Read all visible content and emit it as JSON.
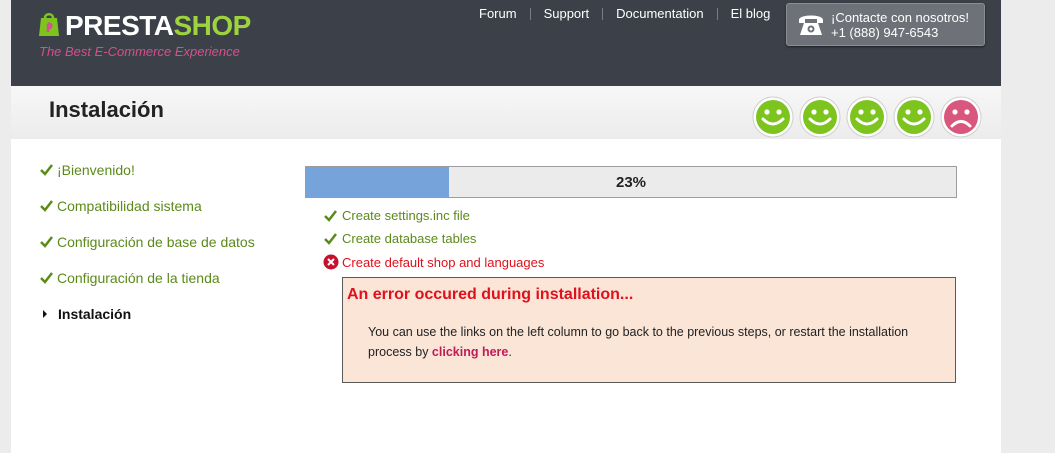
{
  "header": {
    "logo": {
      "word_part1": "PRESTA",
      "word_part2": "SHOP",
      "tagline": "The Best E-Commerce Experience"
    },
    "nav": [
      {
        "label": "Forum"
      },
      {
        "label": "Support"
      },
      {
        "label": "Documentation"
      },
      {
        "label": "El blog"
      }
    ],
    "contact": {
      "label": "¡Contacte con nosotros!",
      "phone": "+1 (888) 947-6543"
    }
  },
  "title": {
    "text": "Instalación"
  },
  "feedback": {
    "smileys": [
      "happy",
      "happy",
      "happy",
      "happy",
      "sad"
    ],
    "colors": {
      "happy": "#7dc41f",
      "sad": "#d9567f"
    }
  },
  "steps": [
    {
      "label": "¡Bienvenido!",
      "status": "done"
    },
    {
      "label": "Compatibilidad sistema",
      "status": "done"
    },
    {
      "label": "Configuración de base de datos",
      "status": "done"
    },
    {
      "label": "Configuración de la tienda",
      "status": "done"
    },
    {
      "label": "Instalación",
      "status": "current"
    }
  ],
  "progress": {
    "percent_label": "23%",
    "fraction": 0.22
  },
  "tasks": [
    {
      "label": "Create settings.inc file",
      "status": "ok"
    },
    {
      "label": "Create database tables",
      "status": "ok"
    },
    {
      "label": "Create default shop and languages",
      "status": "error"
    }
  ],
  "error": {
    "title": "An error occured during installation...",
    "message_before": "You can use the links on the left column to go back to the previous steps, or restart the installation process by ",
    "link_text": "clicking here",
    "message_after": "."
  },
  "colors": {
    "header_bg": "#3b4049",
    "step_green": "#5b8a1a",
    "error_red": "#e0101c",
    "progress_fill": "#76a3d9",
    "error_bg": "#fbe5d7",
    "link": "#c01a58"
  }
}
